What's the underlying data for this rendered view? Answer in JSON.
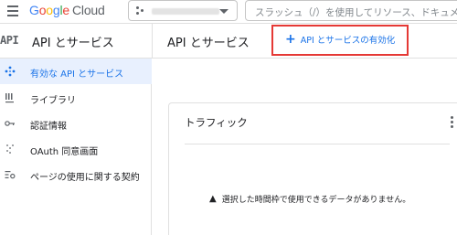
{
  "topbar": {
    "logo_parts": [
      "G",
      "o",
      "o",
      "g",
      "l",
      "e"
    ],
    "logo_suffix": "Cloud",
    "search": {
      "placeholder": "スラッシュ（/）を使用してリソース、ドキュメ"
    }
  },
  "header": {
    "section_title": "API とサービス",
    "page_title": "API とサービス",
    "enable_button_label": "API とサービスの有効化",
    "api_badge": "API"
  },
  "sidebar": {
    "items": [
      {
        "label": "有効な API とサービス",
        "icon": "diamond-dots-icon",
        "active": true
      },
      {
        "label": "ライブラリ",
        "icon": "library-icon",
        "active": false
      },
      {
        "label": "認証情報",
        "icon": "key-icon",
        "active": false
      },
      {
        "label": "OAuth 同意画面",
        "icon": "consent-icon",
        "active": false
      },
      {
        "label": "ページの使用に関する契約",
        "icon": "settings-list-icon",
        "active": false
      }
    ]
  },
  "card": {
    "title": "トラフィック",
    "notice": "選択した時間枠で使用できるデータがありません。"
  },
  "colors": {
    "accent": "#1a73e8",
    "highlight": "#e53935",
    "active_bg": "#e8f0fe"
  }
}
